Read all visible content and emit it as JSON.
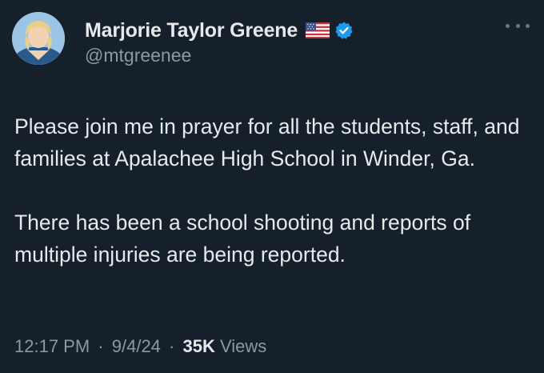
{
  "author": {
    "display_name": "Marjorie Taylor Greene",
    "flag_icon": "us-flag-icon",
    "verified_icon": "verified-badge-icon",
    "handle": "@mtgreenee"
  },
  "tweet": {
    "paragraphs": [
      "Please join me in prayer for all the students, staff, and families at Apalachee High School in Winder, Ga.",
      "There has been a school shooting and reports of multiple injuries are being reported."
    ]
  },
  "meta": {
    "time": "12:17 PM",
    "separator": "·",
    "date": "9/4/24",
    "views_count": "35K",
    "views_label": "Views"
  },
  "colors": {
    "background": "#15202b",
    "text": "#e7e9ea",
    "muted": "#8b98a5",
    "verified": "#1d9bf0"
  },
  "icons": {
    "more": "more-options-icon"
  }
}
